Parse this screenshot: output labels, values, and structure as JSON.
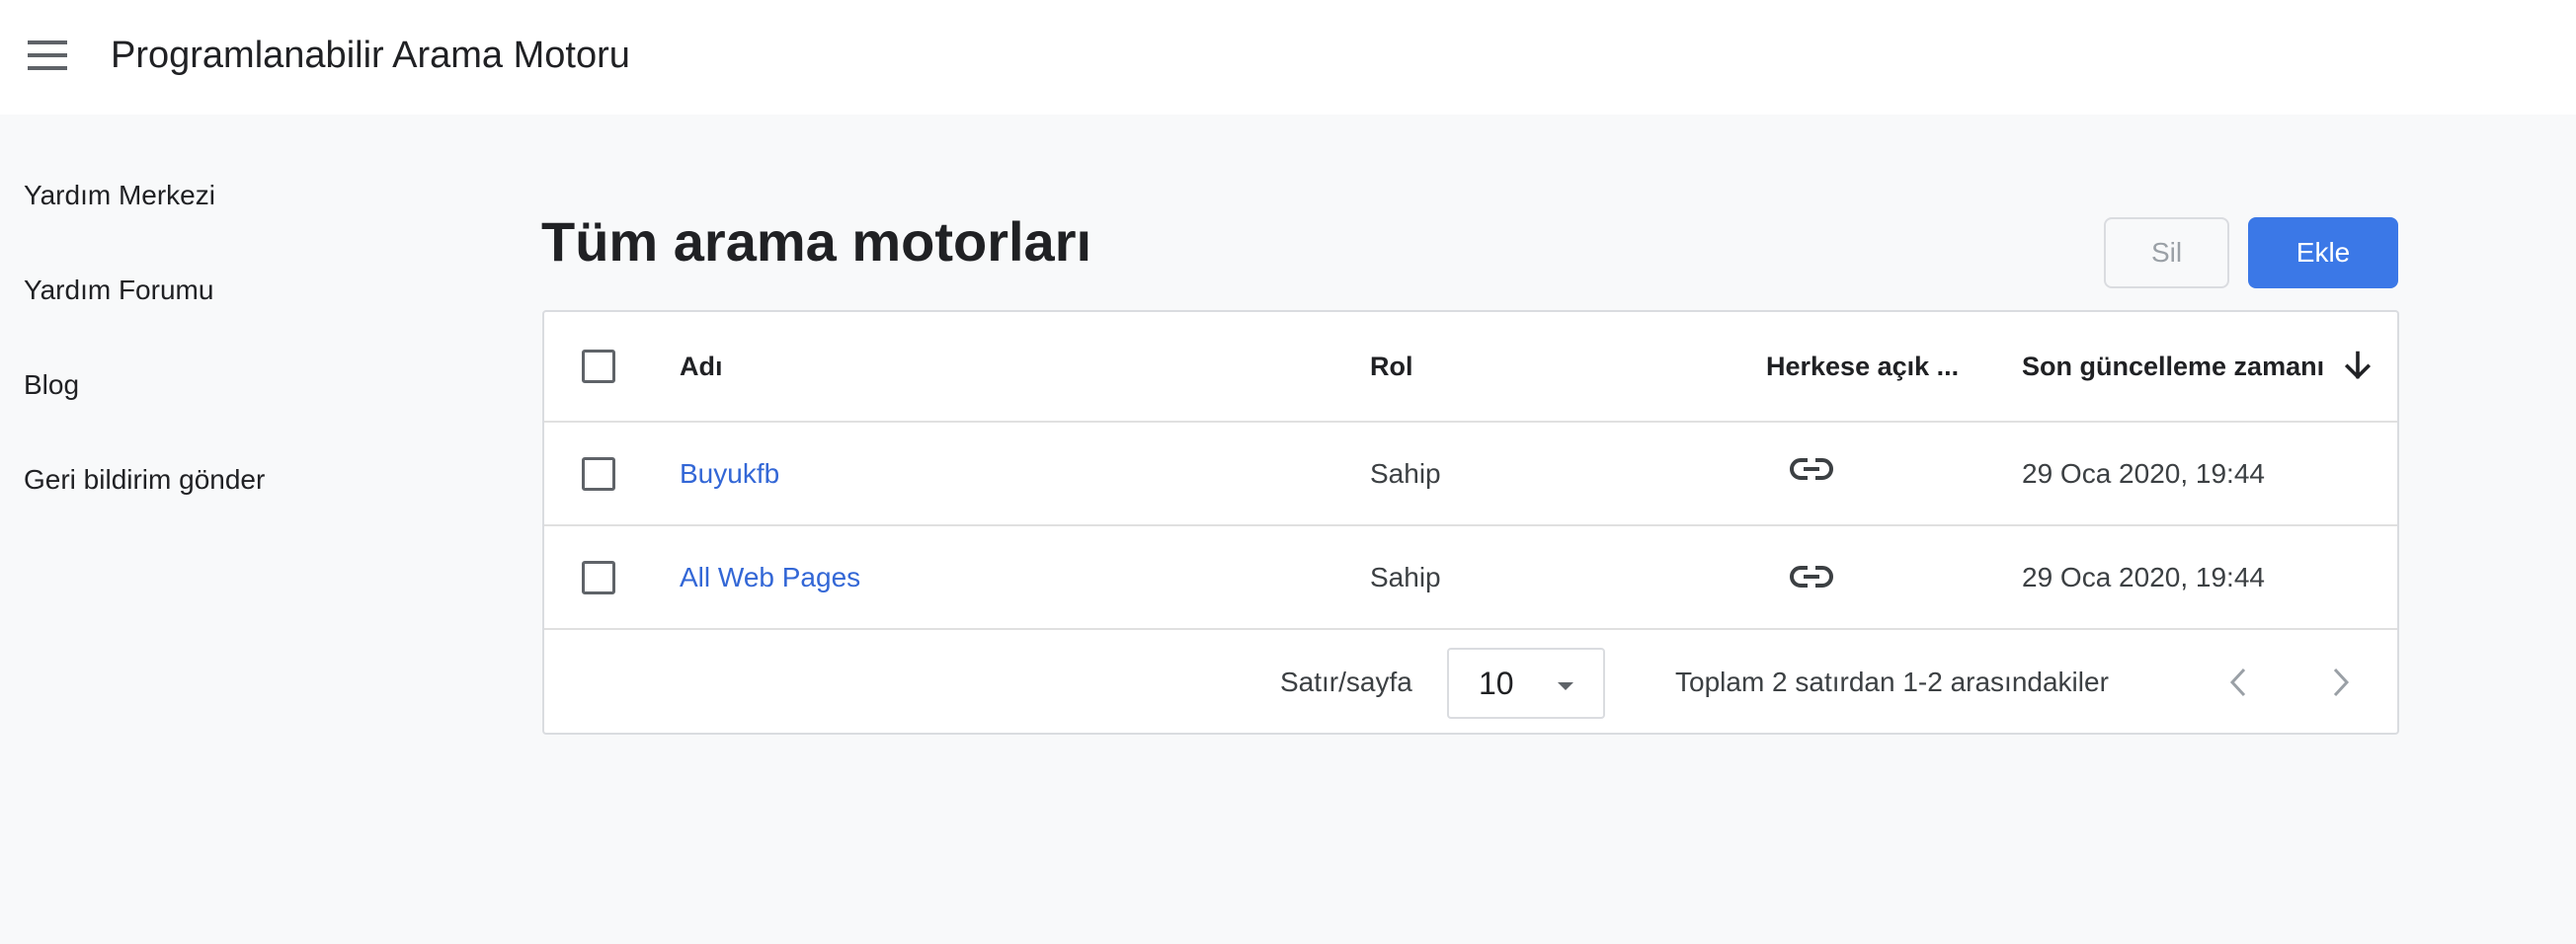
{
  "header": {
    "title": "Programlanabilir Arama Motoru",
    "menu_icon": "hamburger-menu-icon"
  },
  "sidebar": {
    "items": [
      {
        "label": "Yardım Merkezi"
      },
      {
        "label": "Yardım Forumu"
      },
      {
        "label": "Blog"
      },
      {
        "label": "Geri bildirim gönder"
      }
    ]
  },
  "main": {
    "title": "Tüm arama motorları",
    "delete_label": "Sil",
    "add_label": "Ekle",
    "table": {
      "columns": {
        "name": "Adı",
        "role": "Rol",
        "public": "Herkese açık ...",
        "updated": "Son güncelleme zamanı"
      },
      "sort_icon": "arrow-down-icon",
      "rows": [
        {
          "name": "Buyukfb",
          "role": "Sahip",
          "public_icon": "link-icon",
          "updated": "29 Oca 2020, 19:44"
        },
        {
          "name": "All Web Pages",
          "role": "Sahip",
          "public_icon": "link-icon",
          "updated": "29 Oca 2020, 19:44"
        }
      ]
    },
    "pagination": {
      "rows_per_page_label": "Satır/sayfa",
      "rows_per_page_value": "10",
      "range_label": "Toplam 2 satırdan 1-2 arasındakiler"
    }
  },
  "colors": {
    "accent": "#3b78e7",
    "link": "#3367d6",
    "background": "#f8f9fa"
  }
}
